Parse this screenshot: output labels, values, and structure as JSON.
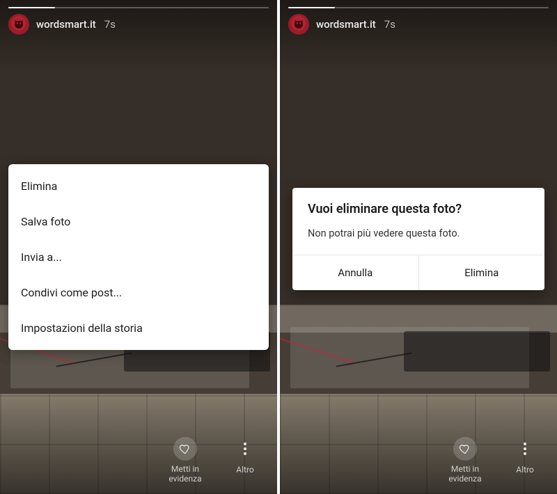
{
  "header": {
    "username": "wordsmart.it",
    "age": "7s"
  },
  "story_progress_percent": 18,
  "bottom_actions": {
    "highlight": {
      "line1": "Metti in",
      "line2": "evidenza"
    },
    "more": "Altro"
  },
  "option_sheet": {
    "items": [
      "Elimina",
      "Salva foto",
      "Invia a...",
      "Condivi come post...",
      "Impostazioni della storia"
    ]
  },
  "delete_dialog": {
    "title": "Vuoi eliminare questa foto?",
    "body": "Non potrai più vedere questa foto.",
    "cancel": "Annulla",
    "confirm": "Elimina"
  }
}
